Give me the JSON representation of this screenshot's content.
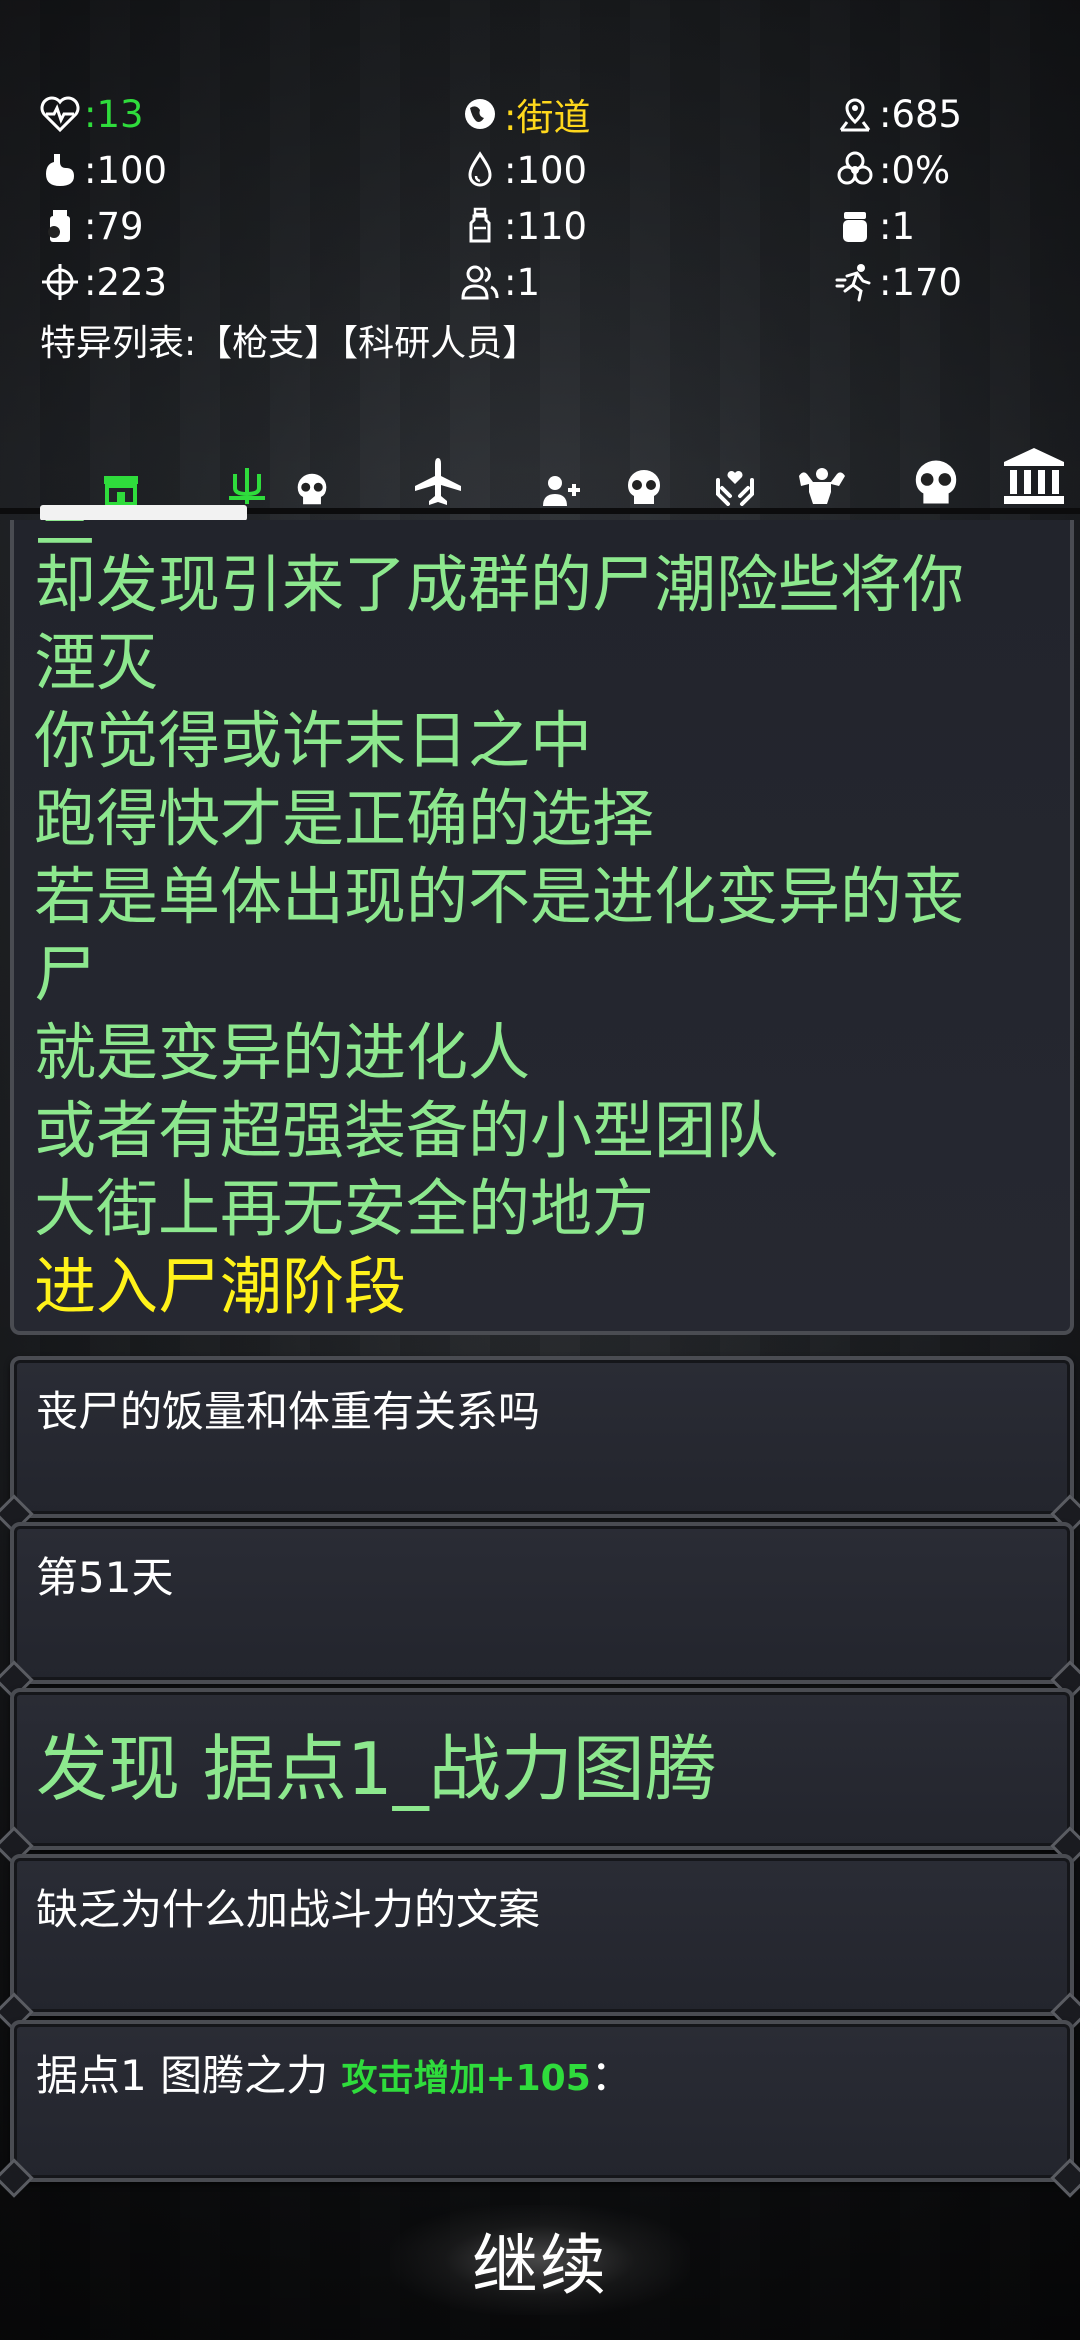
{
  "stats": {
    "health": ":13",
    "location": ":街道",
    "distance": ":685",
    "hunger": ":100",
    "water": ":100",
    "infection": ":0%",
    "food": ":79",
    "drink": ":110",
    "item": ":1",
    "attack": ":223",
    "survivors": ":1",
    "speed": ":170"
  },
  "special_list": "特异列表:【枪支】【科研人员】",
  "tabs": [
    {
      "icon": "shop-icon",
      "color": "#2fdc3c"
    },
    {
      "icon": "trident-icon",
      "color": "#2fdc3c"
    },
    {
      "icon": "skull-icon",
      "color": "#ffffff"
    },
    {
      "icon": "airplane-icon",
      "color": "#ffffff"
    },
    {
      "icon": "add-person-icon",
      "color": "#ffffff"
    },
    {
      "icon": "skull-icon",
      "color": "#ffffff"
    },
    {
      "icon": "hands-heart-icon",
      "color": "#ffffff"
    },
    {
      "icon": "muscle-icon",
      "color": "#ffffff"
    },
    {
      "icon": "skull-icon",
      "color": "#ffffff"
    },
    {
      "icon": "bank-icon",
      "color": "#ffffff"
    }
  ],
  "story": {
    "lines": [
      "三",
      "却发现引来了成群的尸潮险些将你",
      "湮灭",
      "你觉得或许末日之中",
      "跑得快才是正确的选择",
      "若是单体出现的不是进化变异的丧",
      "尸",
      "就是变异的进化人",
      "或者有超强装备的小型团队",
      "大街上再无安全的地方"
    ],
    "highlight": "进入尸潮阶段"
  },
  "messages": {
    "m1": "丧尸的饭量和体重有关系吗",
    "m2": "第51天",
    "m3": "发现 据点1_战力图腾",
    "m4": "缺乏为什么加战斗力的文案",
    "m5_prefix": "据点1 图腾之力 ",
    "m5_green": "攻击增加+105",
    "m5_suffix": "："
  },
  "continue_label": "继续",
  "colors": {
    "green": "#2fdc3c",
    "story_green": "#8de88e",
    "yellow": "#fff21a"
  }
}
